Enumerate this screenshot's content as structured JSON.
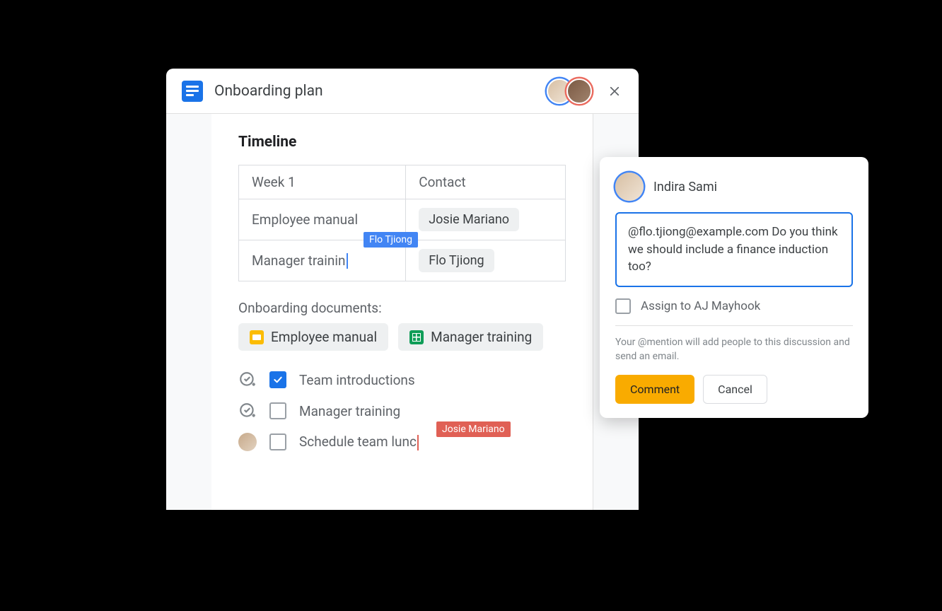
{
  "header": {
    "title": "Onboarding plan"
  },
  "section": {
    "title": "Timeline"
  },
  "table": {
    "h1": "Week 1",
    "h2": "Contact",
    "r1c1": "Employee manual",
    "r1c2": "Josie Mariano",
    "r2c1": "Manager trainin",
    "r2c2": "Flo Tjiong",
    "cursor1_label": "Flo Tjiong"
  },
  "docs_section": {
    "label": "Onboarding documents:",
    "chip1": "Employee manual",
    "chip2": "Manager training"
  },
  "checklist": {
    "item1": "Team introductions",
    "item2": "Manager training",
    "item3": "Schedule team lunc",
    "cursor2_label": "Josie Mariano"
  },
  "comment": {
    "author": "Indira Sami",
    "text": "@flo.tjiong@example.com Do you think we should include a finance induction too?",
    "assign_label": "Assign to AJ Mayhook",
    "hint": "Your @mention will add people to this discussion and send an email.",
    "primary_btn": "Comment",
    "secondary_btn": "Cancel"
  }
}
